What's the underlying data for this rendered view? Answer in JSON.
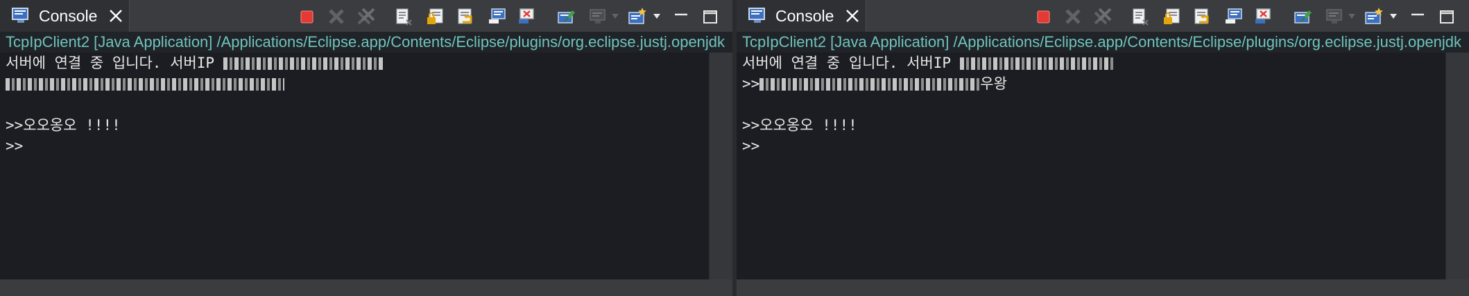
{
  "colors": {
    "background": "#1b1d22",
    "path_text": "#6fc4bd",
    "console_text": "#e8e8e8",
    "terminate_red": "#e53935"
  },
  "panels": [
    {
      "tab": {
        "label": "Console",
        "icon": "console-icon",
        "close_icon": "close-icon"
      },
      "path": "TcpIpClient2 [Java Application] /Applications/Eclipse.app/Contents/Eclipse/plugins/org.eclipse.justj.openjdk",
      "lines": [
        {
          "text": "서버에 연결 중 입니다. 서버IP ",
          "redacted": true
        },
        {
          "text": "",
          "redacted": true,
          "suffix": ""
        },
        {
          "text": ""
        },
        {
          "text": ">>오오옹오 !!!!"
        },
        {
          "text": ">>"
        }
      ]
    },
    {
      "tab": {
        "label": "Console",
        "icon": "console-icon",
        "close_icon": "close-icon"
      },
      "path": "TcpIpClient2 [Java Application] /Applications/Eclipse.app/Contents/Eclipse/plugins/org.eclipse.justj.openjdk",
      "lines": [
        {
          "text": "서버에 연결 중 입니다. 서버IP ",
          "redacted": true
        },
        {
          "text": ">>",
          "redacted": true,
          "suffix": "우왕"
        },
        {
          "text": ""
        },
        {
          "text": ">>오오옹오 !!!!"
        },
        {
          "text": ">>"
        }
      ]
    }
  ],
  "toolbar_icons": [
    "terminate-icon",
    "remove-launch-icon",
    "remove-all-launches-icon",
    "clear-console-icon",
    "scroll-lock-icon",
    "word-wrap-icon",
    "show-on-stdout-icon",
    "show-on-stderr-icon",
    "pin-console-icon",
    "display-console-icon",
    "open-console-icon",
    "minimize-icon",
    "maximize-icon"
  ]
}
